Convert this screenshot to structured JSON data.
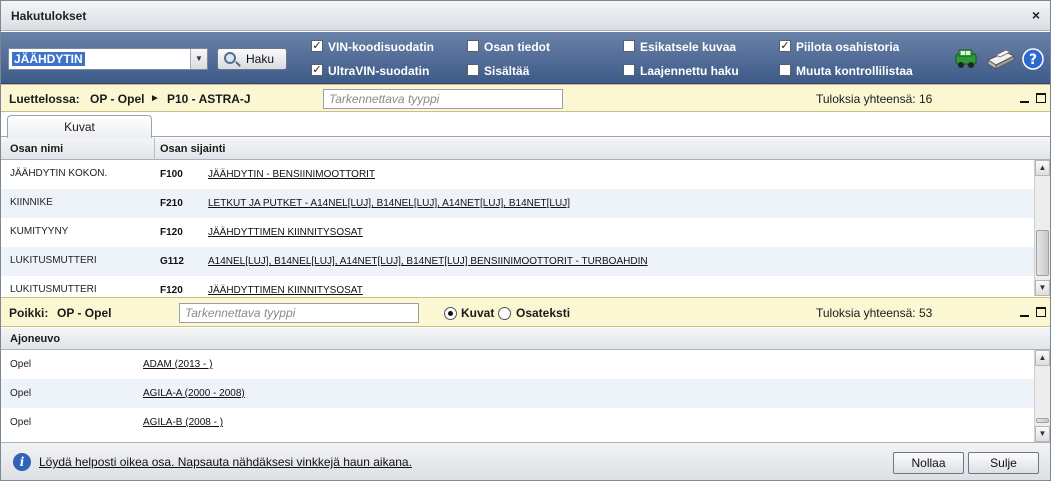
{
  "window": {
    "title": "Hakutulokset",
    "close_glyph": "×"
  },
  "toolbar": {
    "search_value": "JÄÄHDYTIN",
    "search_button": "Haku",
    "options": [
      {
        "label": "VIN-koodisuodatin",
        "checked": true
      },
      {
        "label": "UltraVIN-suodatin",
        "checked": true
      },
      {
        "label": "Osan tiedot",
        "checked": false
      },
      {
        "label": "Sisältää",
        "checked": false
      },
      {
        "label": "Esikatsele kuvaa",
        "checked": false
      },
      {
        "label": "Laajennettu haku",
        "checked": false
      },
      {
        "label": "Piilota osahistoria",
        "checked": true
      },
      {
        "label": "Muuta kontrollilistaa",
        "checked": false
      }
    ],
    "icons": [
      "vehicle-icon",
      "printer-icon",
      "help-icon"
    ]
  },
  "catalogue": {
    "label": "Luettelossa:",
    "path_make": "OP - Opel",
    "path_separator": "►",
    "path_model": "P10 - ASTRA-J",
    "filter_placeholder": "Tarkennettava tyyppi",
    "results_label": "Tuloksia yhteensä: 16"
  },
  "tabs": [
    {
      "label": "Kuvat"
    }
  ],
  "parts_table": {
    "headers": [
      "Osan nimi",
      "Osan sijainti"
    ],
    "rows": [
      {
        "name": "JÄÄHDYTIN KOKON.",
        "code": "F100",
        "location": "JÄÄHDYTIN - BENSIINIMOOTTORIT"
      },
      {
        "name": "KIINNIKE",
        "code": "F210",
        "location": "LETKUT JA PUTKET - A14NEL[LUJ], B14NEL[LUJ], A14NET[LUJ], B14NET[LUJ]"
      },
      {
        "name": "KUMITYYNY",
        "code": "F120",
        "location": "JÄÄHDYTTIMEN KIINNITYSOSAT"
      },
      {
        "name": "LUKITUSMUTTERI",
        "code": "G112",
        "location": "A14NEL[LUJ], B14NEL[LUJ], A14NET[LUJ], B14NET[LUJ] BENSIINIMOOTTORIT - TURBOAHDIN"
      },
      {
        "name": "LUKITUSMUTTERI",
        "code": "F120",
        "location": "JÄÄHDYTTIMEN KIINNITYSOSAT"
      }
    ]
  },
  "cross": {
    "label": "Poikki:",
    "make": "OP - Opel",
    "filter_placeholder": "Tarkennettava tyyppi",
    "radio_kuvat": "Kuvat",
    "radio_osateksti": "Osateksti",
    "selected": "Kuvat",
    "results_label": "Tuloksia yhteensä: 53"
  },
  "vehicles_table": {
    "header": "Ajoneuvo",
    "rows": [
      {
        "make": "Opel",
        "model": "ADAM (2013 - )"
      },
      {
        "make": "Opel",
        "model": "AGILA-A (2000 - 2008)"
      },
      {
        "make": "Opel",
        "model": "AGILA-B (2008 - )"
      }
    ]
  },
  "footer": {
    "tip": "Löydä helposti oikea osa. Napsauta nähdäksesi vinkkejä haun aikana.",
    "reset_button": "Nollaa",
    "close_button": "Sulje"
  },
  "colors": {
    "toolbar": "#3d5a88",
    "strip": "#fbf7d3",
    "row_alt": "#eef3f9",
    "info": "#2f62b8"
  }
}
